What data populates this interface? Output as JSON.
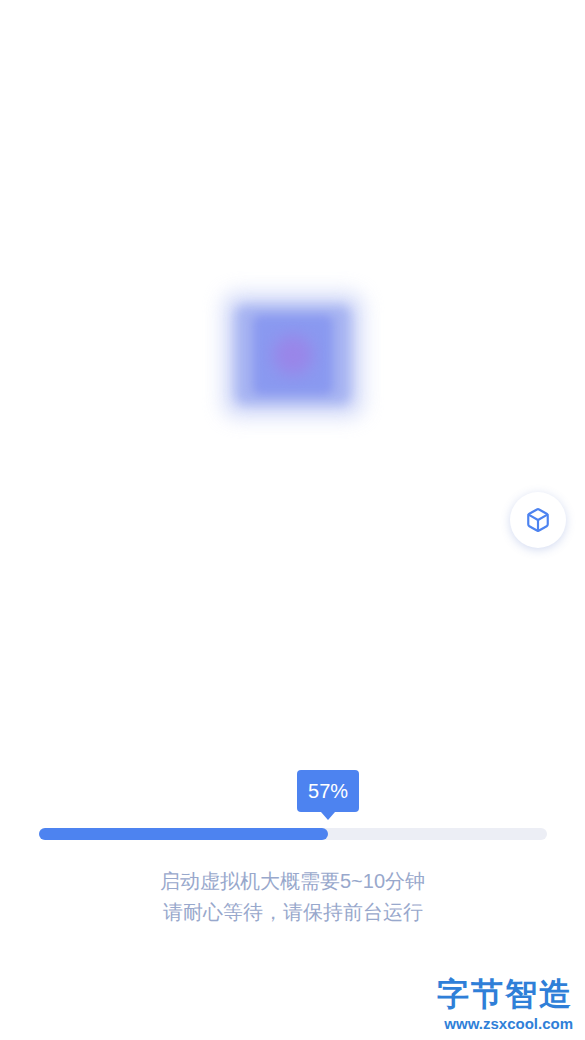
{
  "progress": {
    "level": 0.57,
    "reading": "57%"
  },
  "messages": [
    "启动虚拟机大概需要5~10分钟",
    "请耐心等待，请保持前台运行"
  ],
  "watermark": {
    "title": "字节智造",
    "url": "www.zsxcool.com"
  }
}
